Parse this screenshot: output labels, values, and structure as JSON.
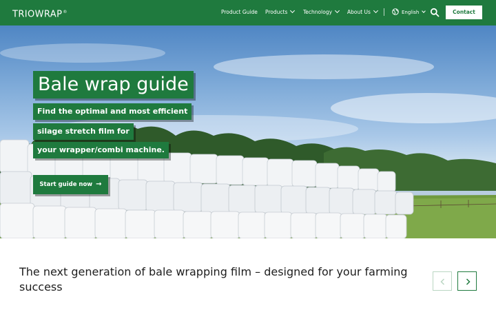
{
  "brand": {
    "logo_text": "TRIOWRAP",
    "logo_mark": "®"
  },
  "nav": {
    "items": [
      {
        "label": "Product Guide",
        "has_dropdown": false
      },
      {
        "label": "Products",
        "has_dropdown": true
      },
      {
        "label": "Technology",
        "has_dropdown": true
      },
      {
        "label": "About Us",
        "has_dropdown": true
      }
    ],
    "language": {
      "label": "English",
      "icon": "globe-icon"
    },
    "search_icon": "search-icon",
    "contact_label": "Contact"
  },
  "hero": {
    "title": "Bale wrap guide",
    "subtitle_lines": [
      "Find the optimal and most efficient",
      "silage stretch film for",
      "your wrapper/combi machine."
    ],
    "cta_label": "Start guide now",
    "cta_icon": "arrow-right-icon"
  },
  "section": {
    "tagline": "The next generation of bale wrapping film – designed for your farming success",
    "prev_icon": "chevron-left-icon",
    "next_icon": "chevron-right-icon"
  },
  "colors": {
    "brand_green": "#1f7a3e",
    "white": "#ffffff",
    "text_dark": "#1e1e1e"
  }
}
